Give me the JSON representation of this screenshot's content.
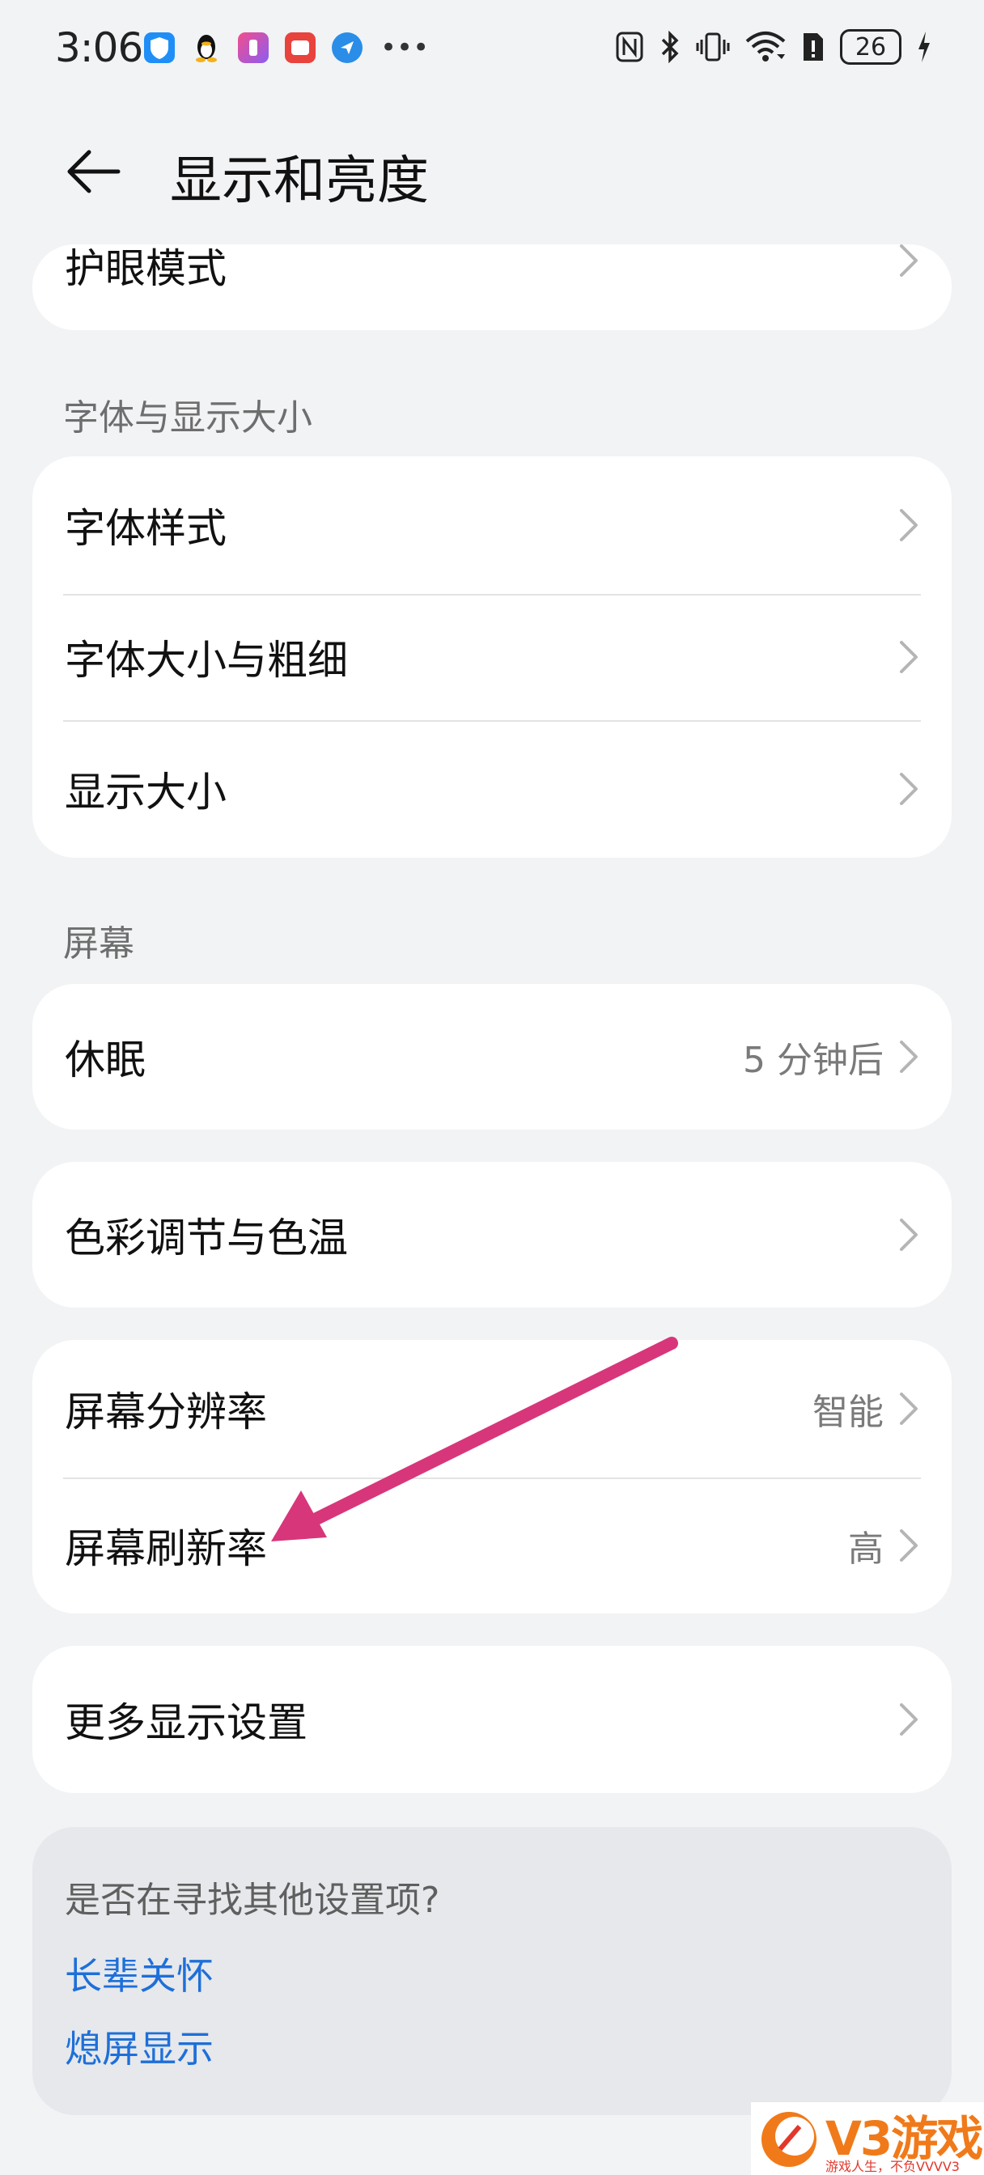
{
  "status_bar": {
    "time": "3:06",
    "battery": "26",
    "app_icons": [
      "shield-icon",
      "qq-penguin-icon",
      "app-icon-purple",
      "app-icon-red",
      "app-icon-blue"
    ]
  },
  "header": {
    "title": "显示和亮度",
    "back_icon": "back-arrow-icon"
  },
  "top_card": {
    "label": "护眼模式"
  },
  "sections": {
    "font_title": "字体与显示大小",
    "screen_title": "屏幕"
  },
  "font_card": {
    "items": [
      {
        "label": "字体样式"
      },
      {
        "label": "字体大小与粗细"
      },
      {
        "label": "显示大小"
      }
    ]
  },
  "sleep_card": {
    "label": "休眠",
    "value": "5 分钟后"
  },
  "color_card": {
    "label": "色彩调节与色温"
  },
  "resolution_card": {
    "items": [
      {
        "label": "屏幕分辨率",
        "value": "智能"
      },
      {
        "label": "屏幕刷新率",
        "value": "高"
      }
    ]
  },
  "more_card": {
    "label": "更多显示设置"
  },
  "suggest": {
    "title": "是否在寻找其他设置项?",
    "links": [
      "长辈关怀",
      "熄屏显示"
    ]
  },
  "watermark": {
    "brand": "V3游戏",
    "tagline": "游戏人生，不负VVVV3"
  },
  "colors": {
    "accent_link": "#1e6fd9",
    "annotation_arrow": "#d8367a",
    "background": "#f1f3f5"
  }
}
